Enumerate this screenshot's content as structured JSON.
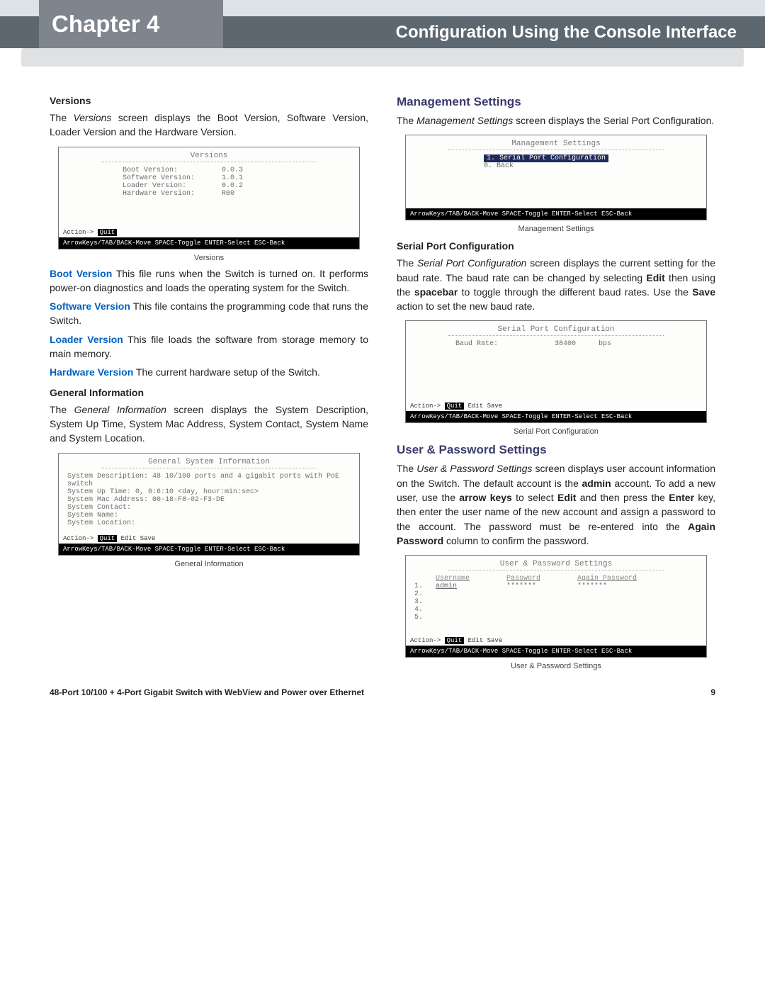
{
  "header": {
    "chapter": "Chapter 4",
    "title": "Configuration Using the Console Interface"
  },
  "left": {
    "versions": {
      "heading": "Versions",
      "intro_a": "The ",
      "intro_em": "Versions",
      "intro_b": " screen displays the Boot Version, Software Version, Loader Version and the Hardware Version.",
      "term_title": "Versions",
      "rows": [
        {
          "k": "Boot Version:",
          "v": "0.0.3"
        },
        {
          "k": "Software Version:",
          "v": "1.0.1"
        },
        {
          "k": "Loader Version:",
          "v": "0.0.2"
        },
        {
          "k": "Hardware Version:",
          "v": "R00"
        }
      ],
      "pre": "Action-> Quit",
      "foot": "ArrowKeys/TAB/BACK-Move  SPACE-Toggle  ENTER-Select  ESC-Back",
      "cap": "Versions",
      "def": [
        {
          "k": "Boot Version",
          "t": "  This file runs when the Switch is turned on. It performs power-on diagnostics and loads the operating system for the Switch."
        },
        {
          "k": "Software Version",
          "t": " This file contains the programming code that runs the Switch."
        },
        {
          "k": "Loader Version",
          "t": "  This file loads the software from storage memory to main memory."
        },
        {
          "k": "Hardware Version",
          "t": " The current hardware setup of the Switch."
        }
      ]
    },
    "general": {
      "heading": "General Information",
      "intro_a": "The ",
      "intro_em": "General Information",
      "intro_b": " screen displays the System Description, System Up Time, System Mac Address, System Contact, System Name and System Location.",
      "term_title": "General System Information",
      "lines": [
        "System Description: 48 10/100 ports and 4 gigabit ports with PoE switch",
        "System Up Time:     0, 0:6:10  <day, hour:min:sec>",
        "System Mac Address: 00-18-F8-02-F3-DE",
        "System Contact:",
        "System Name:",
        "System Location:"
      ],
      "pre": "Action-> Quit  Edit  Save",
      "foot": "ArrowKeys/TAB/BACK-Move  SPACE-Toggle  ENTER-Select  ESC-Back",
      "cap": "General Information"
    }
  },
  "right": {
    "mgmt": {
      "heading": "Management Settings",
      "intro_a": "The ",
      "intro_em": "Management Settings",
      "intro_b": " screen displays the Serial Port Configuration.",
      "term_title": "Management Settings",
      "opt1": "1. Serial Port Configuration",
      "opt0": "0. Back",
      "foot": "ArrowKeys/TAB/BACK-Move  SPACE-Toggle  ENTER-Select  ESC-Back",
      "cap": "Management Settings"
    },
    "serial": {
      "heading": "Serial Port Configuration",
      "p_a": "The ",
      "p_em": "Serial Port Configuration",
      "p_b": " screen displays the current setting for the baud rate. The baud rate can be changed by selecting ",
      "p_bold1": "Edit",
      "p_c": " then using the ",
      "p_bold2": "spacebar",
      "p_d": " to toggle through the different baud rates. Use the ",
      "p_bold3": "Save",
      "p_e": " action to set the new baud rate.",
      "term_title": "Serial Port Configuration",
      "k": "Baud Rate:",
      "v": "38400",
      "unit": "bps",
      "pre": "Action-> Quit  Edit  Save",
      "foot": "ArrowKeys/TAB/BACK-Move  SPACE-Toggle  ENTER-Select  ESC-Back",
      "cap": "Serial Port Configuration"
    },
    "user": {
      "heading": "User & Password Settings",
      "p_a": "The ",
      "p_em": "User & Password Settings",
      "p_b": " screen displays user account information on the Switch. The default account is the ",
      "p_bold1": "admin",
      "p_c": " account. To add a new user, use the ",
      "p_bold2": "arrow keys",
      "p_d": " to select ",
      "p_bold3": "Edit",
      "p_e": " and then press the ",
      "p_bold4": "Enter",
      "p_f": " key, then enter the user name of the new account and assign a password to the account. The password must be re-entered into the ",
      "p_bold5": "Again Password",
      "p_g": " column to confirm the password.",
      "term_title": "User & Password Settings",
      "cols": {
        "u": "Username",
        "p": "Password",
        "a": "Again Password"
      },
      "rows": [
        {
          "n": "1.",
          "u": "admin",
          "p": "*******",
          "a": "*******"
        },
        {
          "n": "2.",
          "u": "",
          "p": "",
          "a": ""
        },
        {
          "n": "3.",
          "u": "",
          "p": "",
          "a": ""
        },
        {
          "n": "4.",
          "u": "",
          "p": "",
          "a": ""
        },
        {
          "n": "5.",
          "u": "",
          "p": "",
          "a": ""
        }
      ],
      "pre": "Action-> Quit  Edit  Save",
      "foot": "ArrowKeys/TAB/BACK-Move  SPACE-Toggle  ENTER-Select  ESC-Back",
      "cap": "User & Password Settings"
    }
  },
  "footer": {
    "product": "48-Port 10/100 + 4-Port Gigabit Switch with WebView and Power over Ethernet",
    "page": "9"
  }
}
